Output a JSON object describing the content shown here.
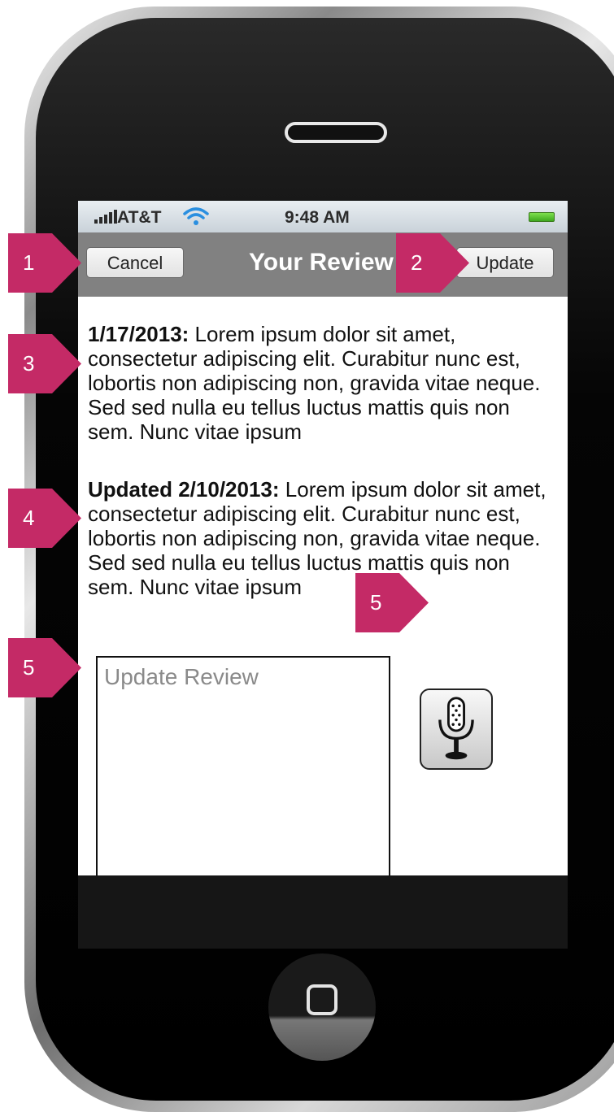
{
  "status_bar": {
    "carrier": "AT&T",
    "time": "9:48 AM"
  },
  "nav": {
    "cancel_label": "Cancel",
    "title": "Your Review",
    "update_label": "Update"
  },
  "reviews": [
    {
      "date_label": "1/17/2013:",
      "text": " Lorem ipsum dolor sit amet, consectetur adipiscing elit. Curabitur nunc est, lobortis non adipiscing non, gravida vitae neque. Sed sed nulla eu tellus luctus mattis quis non sem. Nunc vitae ipsum"
    },
    {
      "date_label": "Updated 2/10/2013:",
      "text": " Lorem ipsum dolor sit amet, consectetur adipiscing elit. Curabitur nunc est, lobortis non adipiscing non, gravida vitae neque. Sed sed nulla eu tellus luctus mattis quis non sem. Nunc vitae ipsum"
    }
  ],
  "update_review": {
    "placeholder": "Update Review"
  },
  "mic_icon": "microphone-icon",
  "callouts": [
    "1",
    "2",
    "3",
    "4",
    "5",
    "5"
  ],
  "colors": {
    "callout": "#c42a66",
    "nav_bar": "#818181",
    "status_bar": "#c9d2d9"
  }
}
